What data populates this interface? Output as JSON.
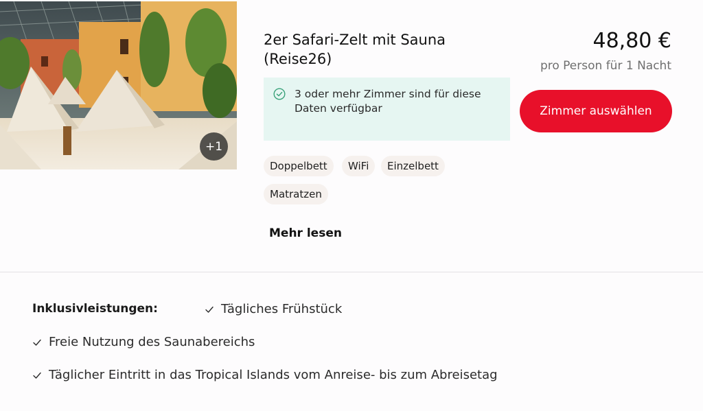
{
  "room": {
    "photo_more_count": "+1",
    "title": "2er Safari-Zelt mit Sauna (Reise26)",
    "price": "48,80 €",
    "price_note": "pro Person für 1 Nacht",
    "availability_text": "3 oder mehr Zimmer sind für diese Daten verfügbar",
    "select_button": "Zimmer auswählen",
    "amenities": [
      "Doppelbett",
      "WiFi",
      "Einzelbett",
      "Matratzen"
    ],
    "read_more": "Mehr lesen"
  },
  "inclusions": {
    "label": "Inklusivleistungen:",
    "items": [
      "Tägliches Frühstück",
      "Freie Nutzung des Saunabereichs",
      "Täglicher Eintritt in das Tropical Islands vom Anreise- bis zum Abreisetag"
    ]
  },
  "colors": {
    "accent": "#e8102a",
    "availability_bg": "#e6f6f2",
    "check_green": "#3aa27a",
    "tag_bg": "#f6f1ee"
  },
  "icons": {
    "availability": "check-circle-icon",
    "inclusion": "checkmark-icon"
  }
}
